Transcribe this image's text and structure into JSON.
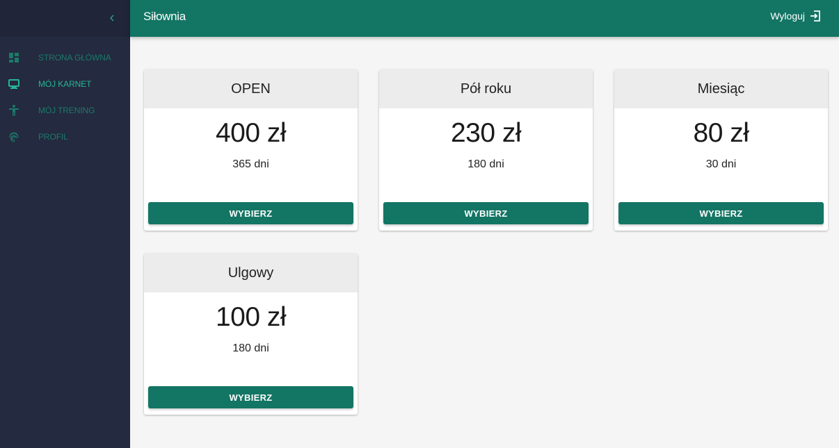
{
  "header": {
    "title": "Siłownia",
    "logout_label": "Wyloguj"
  },
  "sidebar": {
    "items": [
      {
        "label": "STRONA GŁÓWNA",
        "icon": "dashboard-icon",
        "active": false
      },
      {
        "label": "MÓJ KARNET",
        "icon": "card-pass-icon",
        "active": true
      },
      {
        "label": "MÓJ TRENING",
        "icon": "person-icon",
        "active": false
      },
      {
        "label": "PROFIL",
        "icon": "fingerprint-icon",
        "active": false
      }
    ]
  },
  "plans": [
    {
      "name": "OPEN",
      "price": "400 zł",
      "duration": "365 dni",
      "button": "WYBIERZ"
    },
    {
      "name": "Pół roku",
      "price": "230 zł",
      "duration": "180 dni",
      "button": "WYBIERZ"
    },
    {
      "name": "Miesiąc",
      "price": "80 zł",
      "duration": "30 dni",
      "button": "WYBIERZ"
    },
    {
      "name": "Ulgowy",
      "price": "100 zł",
      "duration": "180 dni",
      "button": "WYBIERZ"
    }
  ],
  "colors": {
    "primary": "#137564",
    "sidebar_bg": "#242a40",
    "accent_text": "#26b597",
    "background": "#f5f5f5"
  }
}
